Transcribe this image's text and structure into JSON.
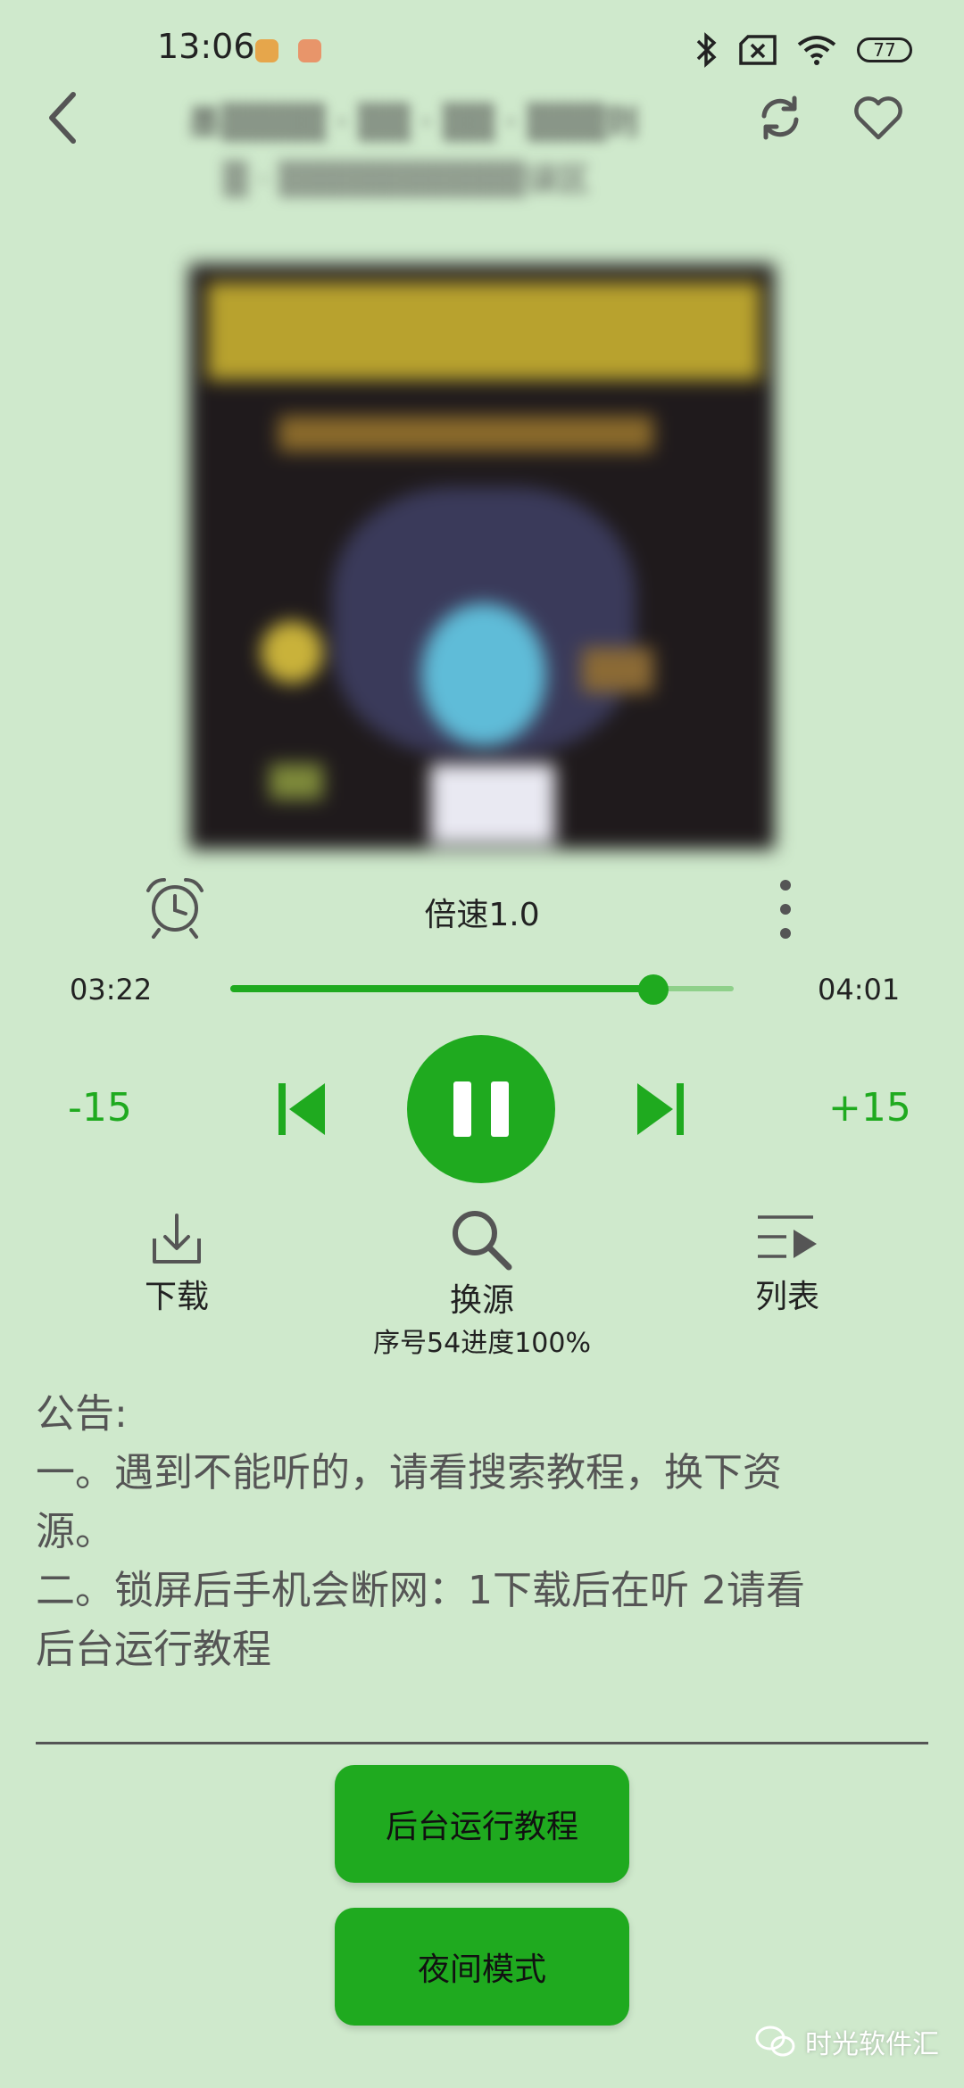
{
  "status_bar": {
    "time": "13:06",
    "battery": "77"
  },
  "header": {
    "title_line1": "墨▒▒▒▒ · ▒▒ · ▒▒ · ▒▒▒则",
    "title_line2": "▒ · ▒▒▒▒▒▒▒▒▒▒误区"
  },
  "player": {
    "speed_label": "倍速1.0",
    "current_time": "03:22",
    "total_time": "04:01",
    "progress": 0.84,
    "rewind_label": "-15",
    "forward_label": "+15",
    "state": "playing"
  },
  "actions": {
    "download_label": "下载",
    "switch_source_label": "换源",
    "playlist_label": "列表",
    "source_progress": "序号54进度100%"
  },
  "notice": {
    "lines": [
      "公告:",
      "一。遇到不能听的，请看搜索教程，换下资",
      "源。",
      "二。锁屏后手机会断网：1下载后在听 2请看",
      "后台运行教程"
    ]
  },
  "buttons": {
    "background_tutorial": "后台运行教程",
    "night_mode": "夜间模式"
  },
  "watermark": "时光软件汇",
  "colors": {
    "background": "#cfe9cc",
    "accent": "#1faa1f",
    "track_light": "#8fd08a"
  }
}
